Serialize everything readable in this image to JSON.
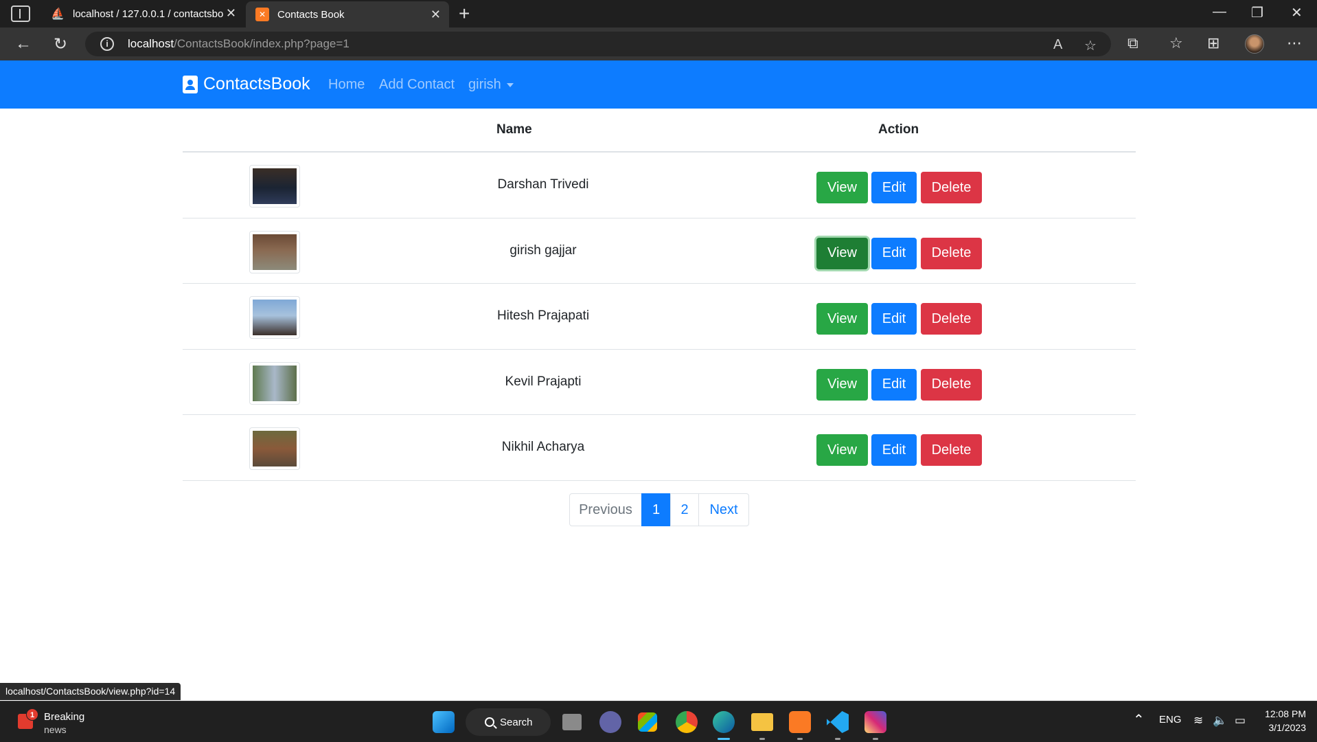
{
  "browser": {
    "tabs": [
      {
        "title": "localhost / 127.0.0.1 / contactsbo",
        "active": false
      },
      {
        "title": "Contacts Book",
        "active": true
      }
    ],
    "url_host": "localhost",
    "url_path": "/ContactsBook/index.php?page=1",
    "status_url": "localhost/ContactsBook/view.php?id=14"
  },
  "app": {
    "brand": "ContactsBook",
    "nav": {
      "home": "Home",
      "add_contact": "Add Contact",
      "user": "girish"
    },
    "table": {
      "headers": {
        "name": "Name",
        "action": "Action"
      },
      "rows": [
        {
          "name": "Darshan Trivedi"
        },
        {
          "name": "girish gajjar"
        },
        {
          "name": "Hitesh Prajapati"
        },
        {
          "name": "Kevil Prajapti"
        },
        {
          "name": "Nikhil Acharya"
        }
      ],
      "buttons": {
        "view": "View",
        "edit": "Edit",
        "delete": "Delete"
      }
    },
    "pagination": {
      "previous": "Previous",
      "pages": [
        "1",
        "2"
      ],
      "current": "1",
      "next": "Next"
    },
    "colors": {
      "primary": "#0d7cff",
      "success": "#28a745",
      "danger": "#dc3545"
    }
  },
  "taskbar": {
    "news_badge": "1",
    "news_line1": "Breaking",
    "news_line2": "news",
    "search": "Search",
    "lang": "ENG",
    "time": "12:08 PM",
    "date": "3/1/2023"
  }
}
